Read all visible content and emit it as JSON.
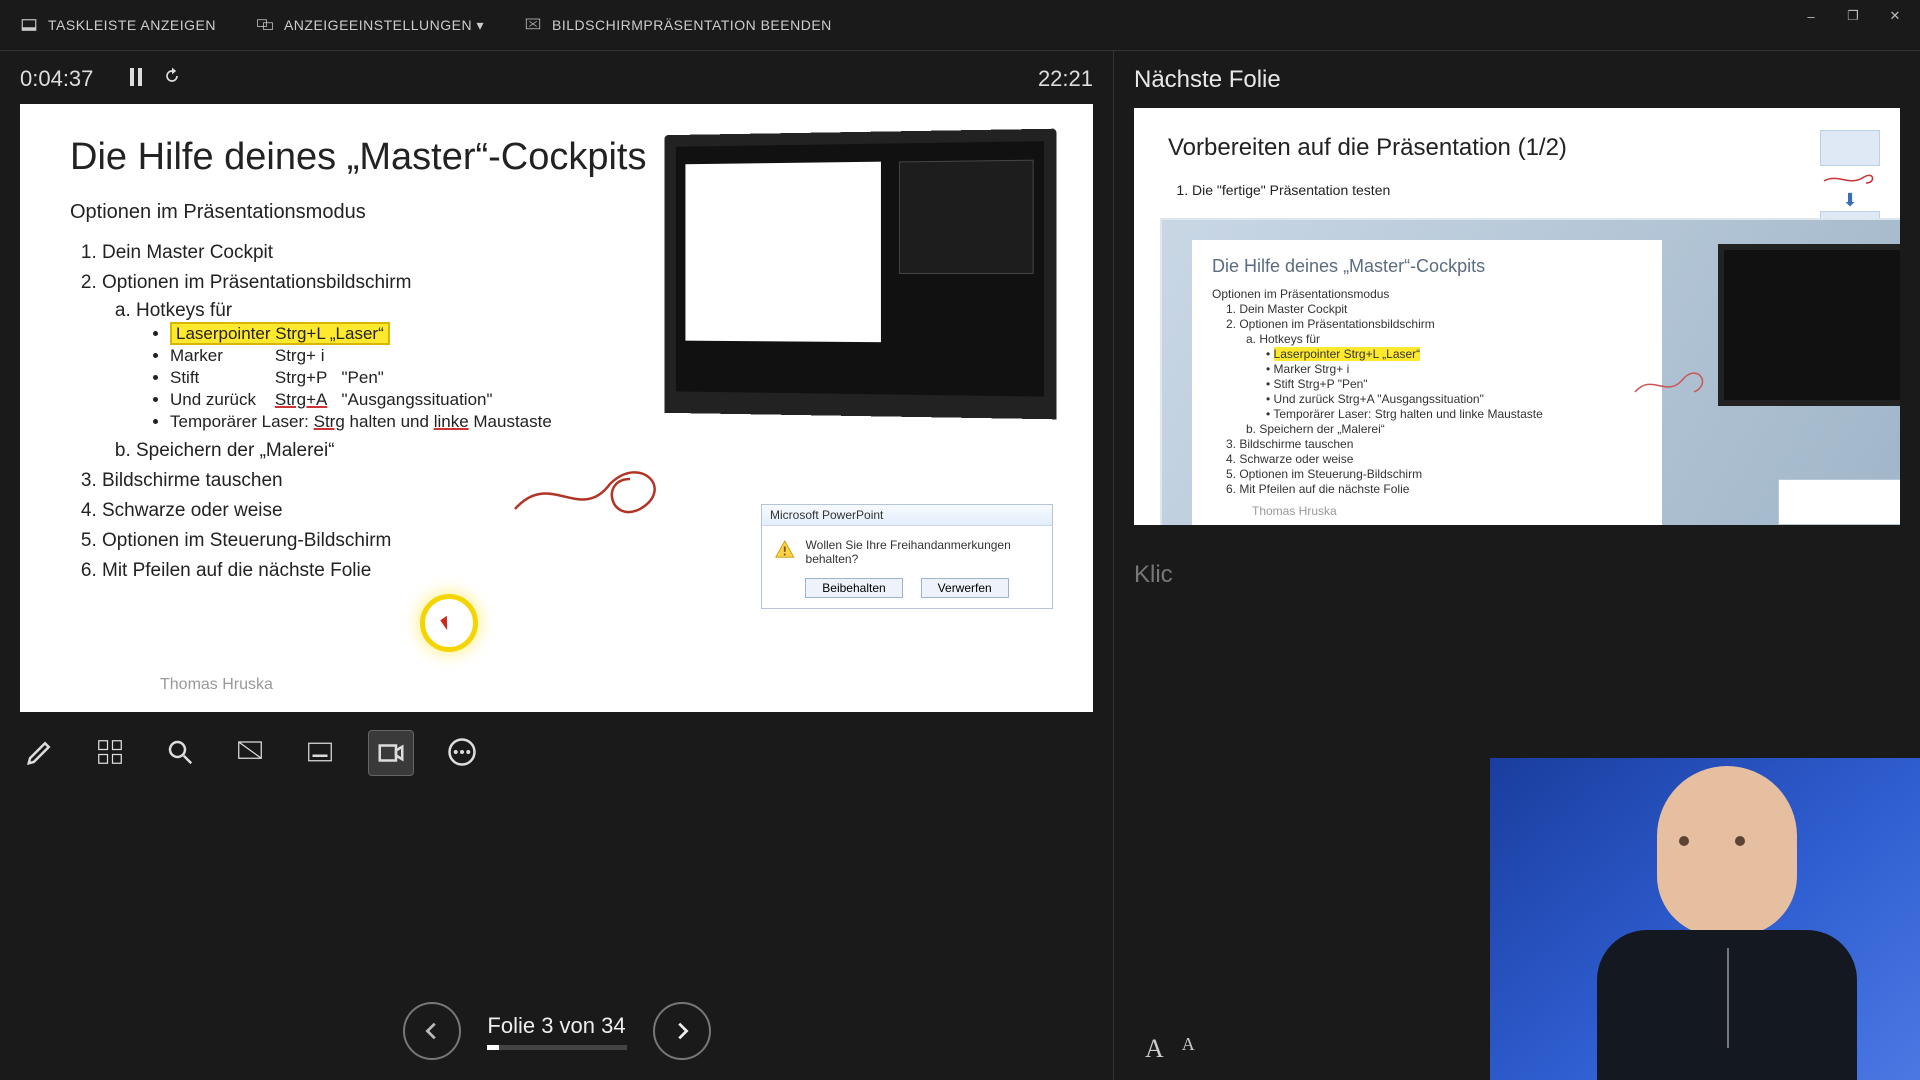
{
  "window": {
    "minimize": "–",
    "restore": "❐",
    "close": "✕"
  },
  "topbar": {
    "show_taskbar": "TASKLEISTE ANZEIGEN",
    "display_settings": "ANZEIGEEINSTELLUNGEN ▾",
    "end_show": "BILDSCHIRMPRÄSENTATION BEENDEN"
  },
  "timer": {
    "elapsed": "0:04:37",
    "clock": "22:21"
  },
  "slide": {
    "title": "Die Hilfe deines „Master“-Cockpits",
    "subtitle": "Optionen im Präsentationsmodus",
    "items": {
      "i1": "Dein Master Cockpit",
      "i2": "Optionen im Präsentationsbildschirm",
      "i2a": "Hotkeys für",
      "h1": "Laserpointer   Strg+L   „Laser“",
      "h2a": "Marker",
      "h2b": "Strg+ i",
      "h3a": "Stift",
      "h3b": "Strg+P",
      "h3c": "\"Pen\"",
      "h4a": "Und zurück",
      "h4b": "Strg+A",
      "h4c": "\"Ausgangssituation\"",
      "h5a": "Temporärer Laser:",
      "h5b": "Strg",
      "h5c": "halten und",
      "h5d": "linke",
      "h5e": "Maustaste",
      "i2b": "Speichern der „Malerei“",
      "i3": "Bildschirme tauschen",
      "i4": "Schwarze oder weise",
      "i5": "Optionen im Steuerung-Bildschirm",
      "i6": "Mit Pfeilen auf die nächste Folie"
    },
    "author": "Thomas Hruska",
    "dialog": {
      "title": "Microsoft PowerPoint",
      "msg": "Wollen Sie Ihre Freihandanmerkungen behalten?",
      "keep": "Beibehalten",
      "discard": "Verwerfen"
    }
  },
  "nav": {
    "label": "Folie 3 von 34"
  },
  "right": {
    "header": "Nächste Folie",
    "next_title": "Vorbereiten auf die Präsentation (1/2)",
    "next_point1": "Die \"fertige\" Präsentation testen",
    "photo": {
      "title": "Die Hilfe deines „Master“-Cockpits",
      "sub": "Optionen im Präsentationsmodus",
      "l1": "Dein Master Cockpit",
      "l2": "Optionen im Präsentationsbildschirm",
      "l2a": "Hotkeys für",
      "p1": "Laserpointer  Strg+L   „Laser“",
      "p2": "Marker           Strg+ i",
      "p3": "Stift               Strg+P   \"Pen\"",
      "p4": "Und zurück    Strg+A   \"Ausgangssituation\"",
      "p5": "Temporärer Laser:  Strg halten und linke Maustaste",
      "l2b": "Speichern der „Malerei“",
      "l3": "Bildschirme tauschen",
      "l4": "Schwarze oder weise",
      "l5": "Optionen im Steuerung-Bildschirm",
      "l6": "Mit Pfeilen auf die nächste Folie",
      "author": "Thomas Hruska"
    },
    "notes_placeholder": "Klic"
  },
  "fontsize": {
    "inc": "A",
    "dec": "A"
  }
}
